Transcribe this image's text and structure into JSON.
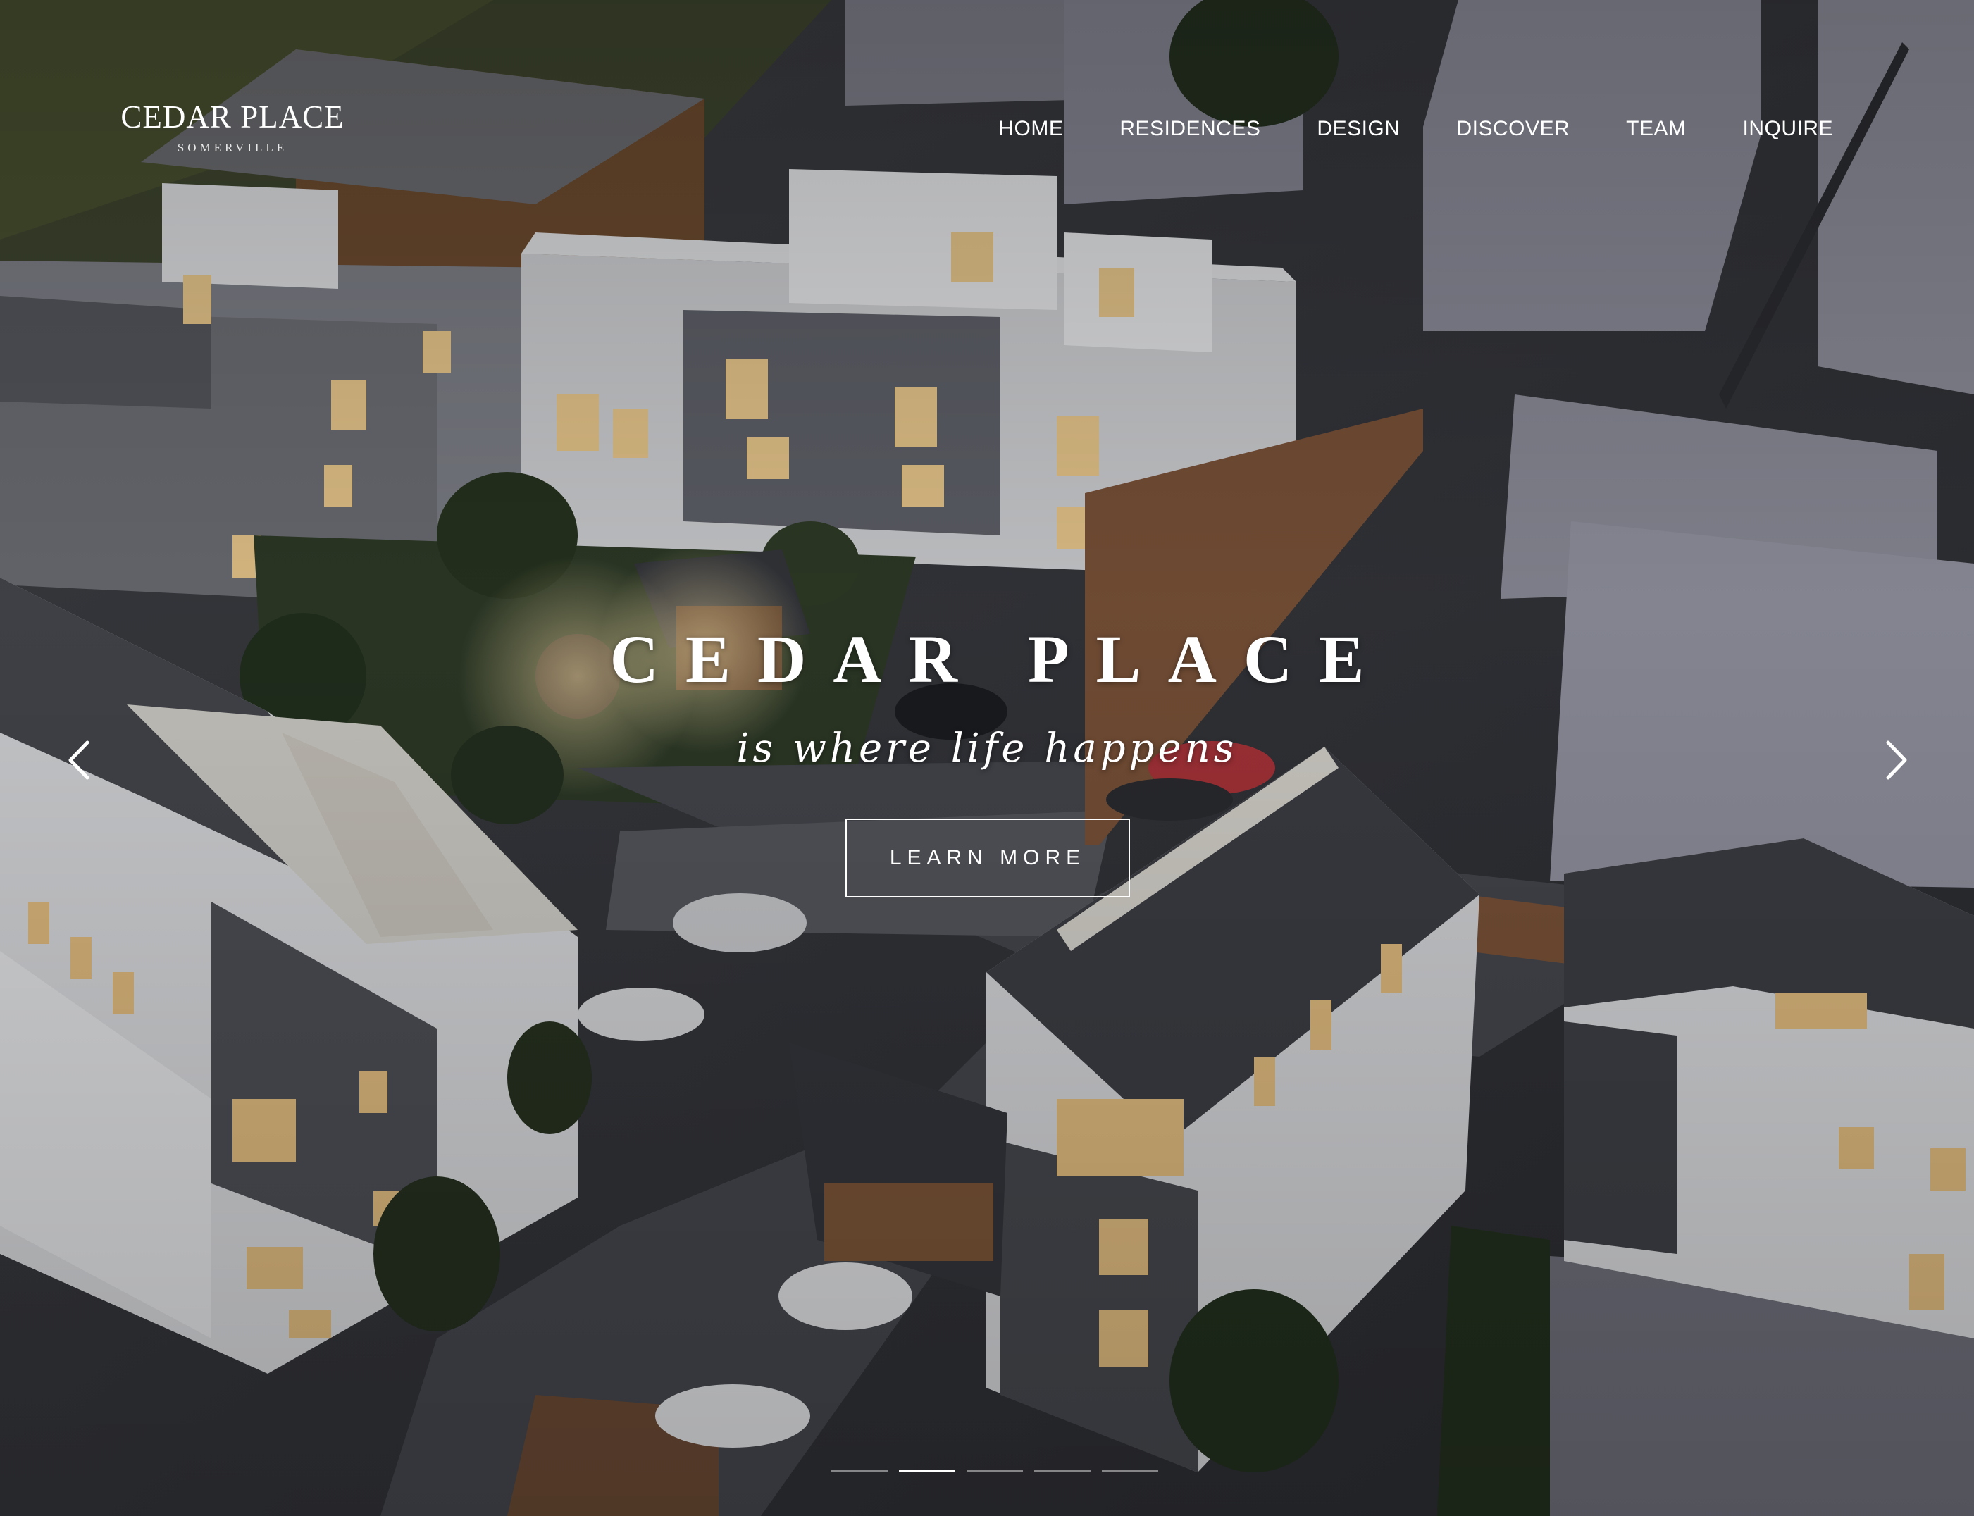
{
  "header": {
    "logo_name": "CEDAR PLACE",
    "logo_sub": "SOMERVILLE",
    "nav": [
      "HOME",
      "RESIDENCES",
      "DESIGN",
      "DISCOVER",
      "TEAM",
      "INQUIRE"
    ]
  },
  "hero": {
    "title": "CEDAR PLACE",
    "tagline": "is where life happens",
    "cta_label": "LEARN MORE",
    "prev_icon": "chevron-left-icon",
    "next_icon": "chevron-right-icon",
    "slides_count": 5,
    "active_slide": 1
  },
  "colors": {
    "text": "#ffffff",
    "overlay": "#1c1d20"
  }
}
